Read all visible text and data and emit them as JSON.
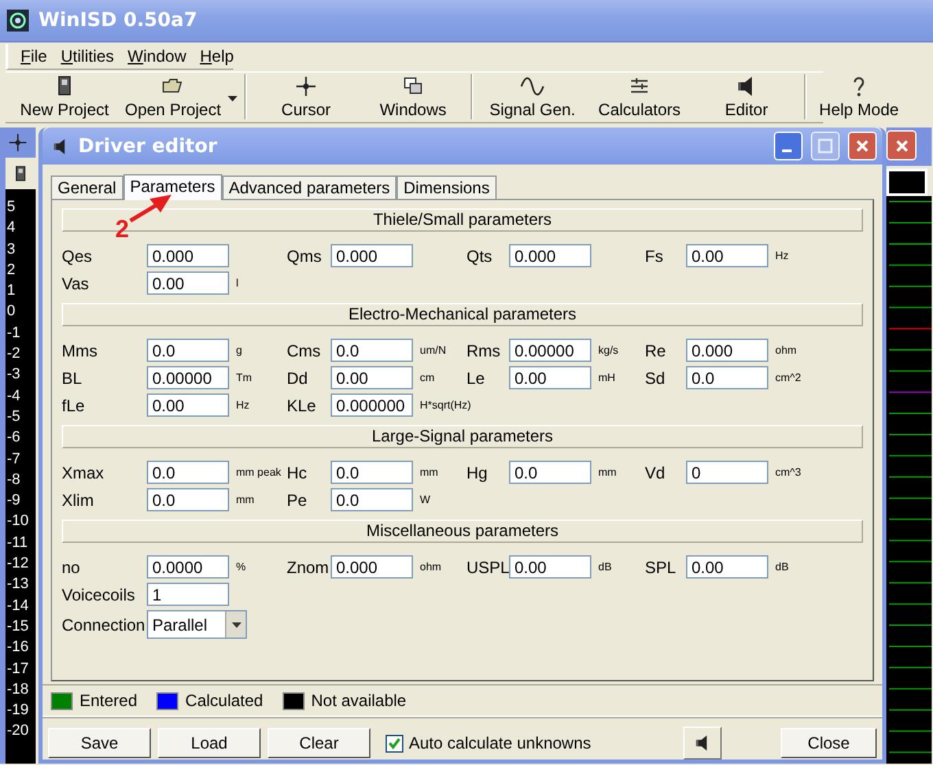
{
  "window": {
    "title": "WinISD 0.50a7"
  },
  "menu": [
    "File",
    "Utilities",
    "Window",
    "Help"
  ],
  "toolbar": {
    "groups": [
      [
        {
          "label": "New Project",
          "dropdown": false
        },
        {
          "label": "Open Project",
          "dropdown": true
        }
      ],
      [
        {
          "label": "Cursor",
          "dropdown": false
        },
        {
          "label": "Windows",
          "dropdown": false
        }
      ],
      [
        {
          "label": "Signal Gen.",
          "dropdown": false
        },
        {
          "label": "Calculators",
          "dropdown": false
        },
        {
          "label": "Editor",
          "dropdown": false
        }
      ],
      [
        {
          "label": "Help Mode",
          "dropdown": false
        }
      ]
    ]
  },
  "graph": {
    "y_axis": [
      "5",
      "4",
      "3",
      "2",
      "1",
      "0",
      "-1",
      "-2",
      "-3",
      "-4",
      "-5",
      "-6",
      "-7",
      "-8",
      "-9",
      "-10",
      "-11",
      "-12",
      "-13",
      "-14",
      "-15",
      "-16",
      "-17",
      "-18",
      "-19",
      "-20"
    ]
  },
  "dialog": {
    "title": "Driver editor",
    "tabs": [
      {
        "label": "General",
        "selected": false
      },
      {
        "label": "Parameters",
        "selected": true
      },
      {
        "label": "Advanced parameters",
        "selected": false
      },
      {
        "label": "Dimensions",
        "selected": false
      }
    ],
    "annotation": "2",
    "sections": [
      {
        "title": "Thiele/Small parameters",
        "rows": [
          [
            {
              "kind": "input",
              "label": "Qes",
              "value": "0.000"
            },
            {
              "kind": "input",
              "label": "Qms",
              "value": "0.000"
            },
            {
              "kind": "input",
              "label": "Qts",
              "value": "0.000"
            },
            {
              "kind": "input",
              "label": "Fs",
              "value": "0.00",
              "unit": "Hz"
            }
          ],
          [
            {
              "kind": "input",
              "label": "Vas",
              "value": "0.00",
              "unit": "l"
            }
          ]
        ]
      },
      {
        "title": "Electro-Mechanical parameters",
        "rows": [
          [
            {
              "kind": "input",
              "label": "Mms",
              "value": "0.0",
              "unit": "g"
            },
            {
              "kind": "input",
              "label": "Cms",
              "value": "0.0",
              "unit": "um/N"
            },
            {
              "kind": "input",
              "label": "Rms",
              "value": "0.00000",
              "unit": "kg/s"
            },
            {
              "kind": "input",
              "label": "Re",
              "value": "0.000",
              "unit": "ohm"
            }
          ],
          [
            {
              "kind": "input",
              "label": "BL",
              "value": "0.00000",
              "unit": "Tm"
            },
            {
              "kind": "input",
              "label": "Dd",
              "value": "0.00",
              "unit": "cm"
            },
            {
              "kind": "input",
              "label": "Le",
              "value": "0.00",
              "unit": "mH"
            },
            {
              "kind": "input",
              "label": "Sd",
              "value": "0.0",
              "unit": "cm^2"
            }
          ],
          [
            {
              "kind": "input",
              "label": "fLe",
              "value": "0.00",
              "unit": "Hz"
            },
            {
              "kind": "input",
              "label": "KLe",
              "value": "0.000000",
              "unit": "H*sqrt(Hz)"
            }
          ]
        ]
      },
      {
        "title": "Large-Signal parameters",
        "rows": [
          [
            {
              "kind": "input",
              "label": "Xmax",
              "value": "0.0",
              "unit": "mm peak"
            },
            {
              "kind": "input",
              "label": "Hc",
              "value": "0.0",
              "unit": "mm"
            },
            {
              "kind": "input",
              "label": "Hg",
              "value": "0.0",
              "unit": "mm"
            },
            {
              "kind": "input",
              "label": "Vd",
              "value": "0",
              "unit": "cm^3"
            }
          ],
          [
            {
              "kind": "input",
              "label": "Xlim",
              "value": "0.0",
              "unit": "mm"
            },
            {
              "kind": "input",
              "label": "Pe",
              "value": "0.0",
              "unit": "W"
            }
          ]
        ]
      },
      {
        "title": "Miscellaneous parameters",
        "rows": [
          [
            {
              "kind": "input",
              "label": "no",
              "value": "0.0000",
              "unit": "%"
            },
            {
              "kind": "input",
              "label": "Znom",
              "value": "0.000",
              "unit": "ohm"
            },
            {
              "kind": "input",
              "label": "USPL",
              "value": "0.00",
              "unit": "dB"
            },
            {
              "kind": "input",
              "label": "SPL",
              "value": "0.00",
              "unit": "dB"
            }
          ],
          [
            {
              "kind": "input",
              "label": "Voicecoils",
              "value": "1"
            }
          ],
          [
            {
              "kind": "select",
              "label": "Connection",
              "value": "Parallel"
            }
          ]
        ]
      }
    ],
    "legend": [
      {
        "label": "Entered",
        "color": "#008000"
      },
      {
        "label": "Calculated",
        "color": "#0000ff"
      },
      {
        "label": "Not available",
        "color": "#000000"
      }
    ],
    "buttons": [
      "Save",
      "Load",
      "Clear"
    ],
    "auto_calculate": {
      "label": "Auto calculate unknowns",
      "checked": true
    },
    "close_button": "Close"
  }
}
